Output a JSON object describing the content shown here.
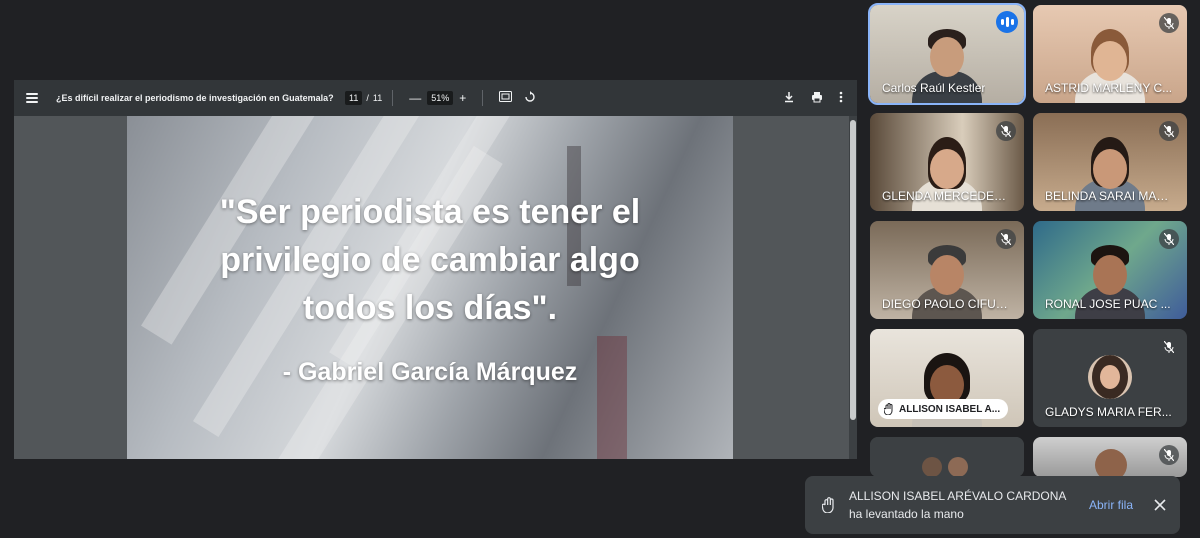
{
  "pdf": {
    "title": "¿Es difícil realizar el periodismo de investigación en Guatemala?",
    "page_current": "11",
    "page_total": "11",
    "page_separator": "/",
    "zoom": "51%",
    "zoom_out": "—",
    "zoom_in": "+",
    "icons": {
      "menu": "menu-icon",
      "fit": "fit-page-icon",
      "rotate": "rotate-icon",
      "download": "download-icon",
      "print": "print-icon",
      "more": "more-vert-icon"
    }
  },
  "slide": {
    "quote": "\"Ser periodista es tener el privilegio de cambiar algo todos los días\".",
    "author": "- Gabriel García Márquez"
  },
  "participants": [
    {
      "name": "Carlos Raúl Kestler",
      "status": "speaking"
    },
    {
      "name": "ASTRID MARLENY C...",
      "status": "muted"
    },
    {
      "name": "GLENDA MERCEDES ...",
      "status": "muted"
    },
    {
      "name": "BELINDA SARAI MAR...",
      "status": "muted"
    },
    {
      "name": "DIEGO PAOLO CIFUE...",
      "status": "muted"
    },
    {
      "name": "RONAL JOSE PUAC ...",
      "status": "muted"
    },
    {
      "name": "ALLISON ISABEL A...",
      "status": "hand-raised"
    },
    {
      "name": "GLADYS MARIA FER...",
      "status": "muted"
    },
    {
      "name": "",
      "status": ""
    },
    {
      "name": "",
      "status": "muted"
    }
  ],
  "toast": {
    "name": "ALLISON ISABEL ARÉVALO CARDONA",
    "message": "ha levantado la mano",
    "action": "Abrir fila"
  },
  "colors": {
    "background": "#202124",
    "toolbar": "#323639",
    "accent": "#8ab4f8",
    "speaking": "#1a73e8"
  }
}
